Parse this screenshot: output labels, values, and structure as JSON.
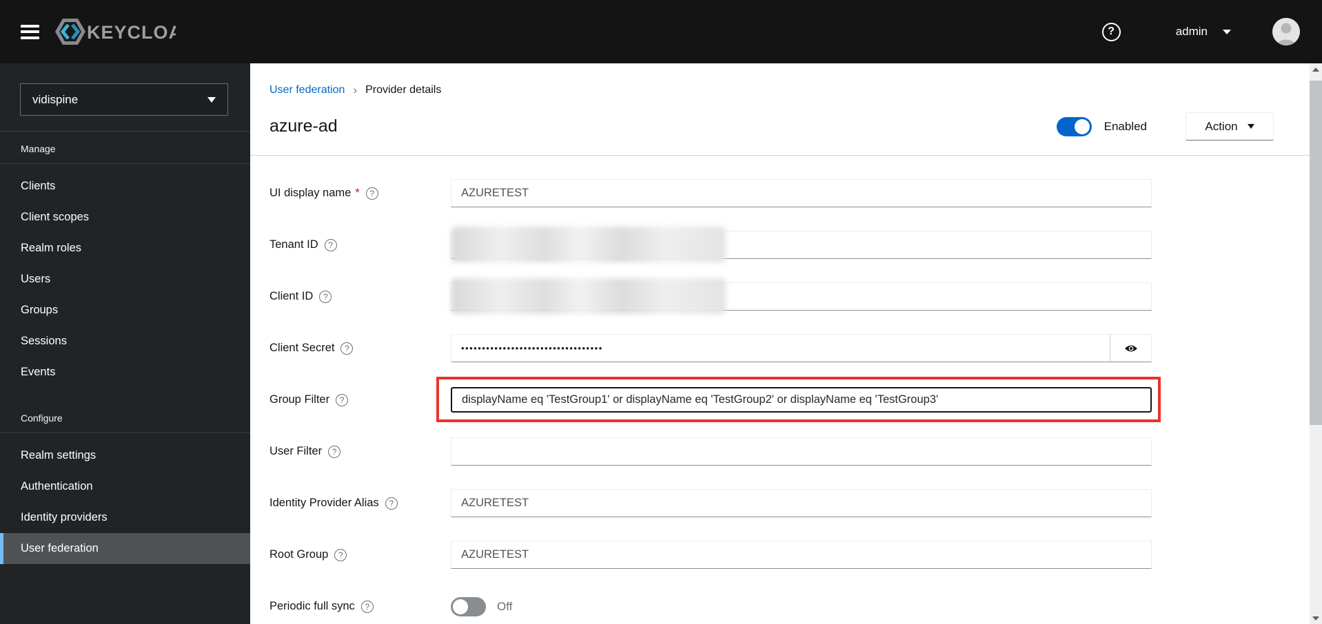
{
  "topbar": {
    "brand": "KEYCLOAK",
    "username": "admin"
  },
  "sidebar": {
    "realm": "vidispine",
    "groups": [
      {
        "label": "Manage",
        "items": [
          "Clients",
          "Client scopes",
          "Realm roles",
          "Users",
          "Groups",
          "Sessions",
          "Events"
        ]
      },
      {
        "label": "Configure",
        "items": [
          "Realm settings",
          "Authentication",
          "Identity providers",
          "User federation"
        ]
      }
    ],
    "selected_item": "User federation"
  },
  "breadcrumb": {
    "parent": "User federation",
    "current": "Provider details"
  },
  "header": {
    "title": "azure-ad",
    "enabled_label": "Enabled",
    "action_label": "Action"
  },
  "form": {
    "fields": [
      {
        "key": "ui-display-name",
        "label": "UI display name",
        "required": true,
        "type": "text",
        "value": "AZURETEST"
      },
      {
        "key": "tenant-id",
        "label": "Tenant ID",
        "type": "redacted",
        "value": ""
      },
      {
        "key": "client-id",
        "label": "Client ID",
        "type": "redacted",
        "value": ""
      },
      {
        "key": "client-secret",
        "label": "Client Secret",
        "type": "password",
        "value": "••••••••••••••••••••••••••••••••••"
      },
      {
        "key": "group-filter",
        "label": "Group Filter",
        "type": "text",
        "value": "displayName eq 'TestGroup1' or displayName eq 'TestGroup2' or displayName eq 'TestGroup3'",
        "highlighted": true
      },
      {
        "key": "user-filter",
        "label": "User Filter",
        "type": "text",
        "value": ""
      },
      {
        "key": "identity-provider-alias",
        "label": "Identity Provider Alias",
        "type": "text",
        "value": "AZURETEST"
      },
      {
        "key": "root-group",
        "label": "Root Group",
        "type": "text",
        "value": "AZURETEST"
      },
      {
        "key": "periodic-full-sync",
        "label": "Periodic full sync",
        "type": "switch",
        "value": "Off"
      }
    ]
  },
  "icons": {
    "question": "?",
    "breadcrumb_separator": "›"
  },
  "colors": {
    "accent_blue": "#0066cc",
    "nav_selected_accent": "#73bcf7",
    "annotation_red": "#e7342c",
    "link_blue": "#0066cc"
  }
}
